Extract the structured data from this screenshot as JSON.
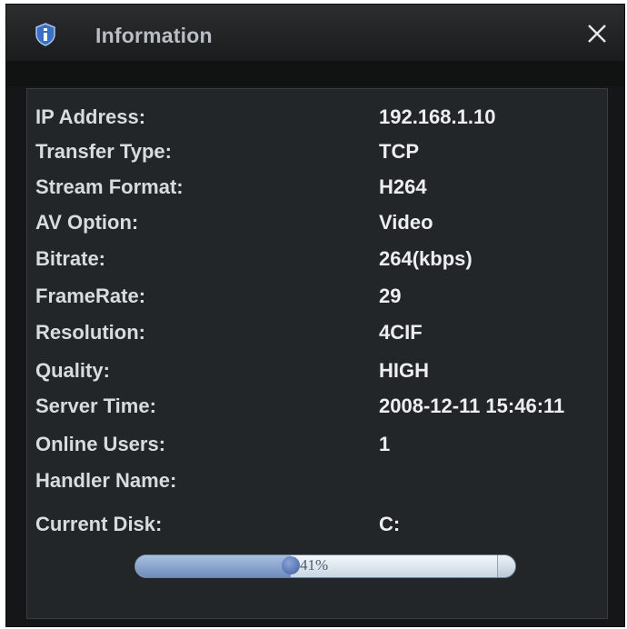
{
  "window": {
    "title": "Information",
    "title_icon": "info-shield-icon",
    "close_icon": "close-icon"
  },
  "info_rows": [
    {
      "label": "IP Address:",
      "value": "192.168.1.10"
    },
    {
      "label": "Transfer Type:",
      "value": "TCP"
    },
    {
      "label": "Stream Format:",
      "value": "H264"
    },
    {
      "label": "AV Option:",
      "value": "Video"
    },
    {
      "label": "Bitrate:",
      "value": "264(kbps)"
    },
    {
      "label": "FrameRate:",
      "value": "29"
    },
    {
      "label": "Resolution:",
      "value": "4CIF"
    },
    {
      "label": "Quality:",
      "value": "HIGH"
    },
    {
      "label": "Server Time:",
      "value": "2008-12-11 15:46:11"
    },
    {
      "label": "Online Users:",
      "value": "1"
    },
    {
      "label": "Handler Name:",
      "value": ""
    },
    {
      "label": "Current Disk:",
      "value": "C:"
    }
  ],
  "disk_usage": {
    "percent": 41,
    "label": "41%"
  },
  "colors": {
    "background": "#141617",
    "panel": "#232628",
    "text": "#d9dcdf",
    "progress_fill": "#7a96c6",
    "progress_track": "#dde7ef"
  }
}
